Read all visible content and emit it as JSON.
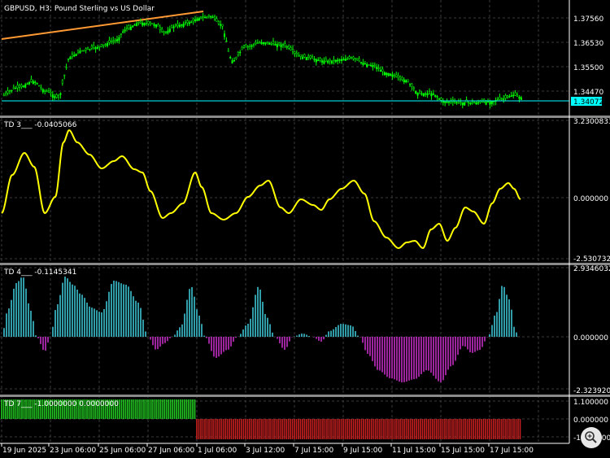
{
  "symbol_title": "GBPUSD, H3:  Pound Sterling vs US Dollar",
  "main_pane": {
    "price_labels": [
      "1.37560",
      "1.36530",
      "1.35500",
      "1.34470"
    ],
    "current_price": "1.34072",
    "colors": {
      "bull": "#00ff00",
      "trendline": "#ff9933",
      "hline": "#00ffff",
      "badge": "#00ffff"
    }
  },
  "pane_td3": {
    "label": "TD 3___ -0.0405066",
    "max_label": "3.2300833",
    "zero_label": "0.000000",
    "min_label": "-2.5307322",
    "line_color": "#ffff00"
  },
  "pane_td4": {
    "label": "TD 4___ -0.1145341",
    "max_label": "2.9346032",
    "zero_label": "0.000000",
    "min_label": "-2.3239202",
    "pos_color": "#40d0e0",
    "neg_color": "#d030d0"
  },
  "pane_td7": {
    "label": "TD 7___ -1.0000000 0.0000000",
    "max_label": "1.100000",
    "zero_label": "0.000000",
    "min_label": "-1.100000",
    "pos_color": "#22cc22",
    "neg_color": "#cc2020"
  },
  "time_axis": [
    "19 Jun 2025",
    "23 Jun 06:00",
    "25 Jun 06:00",
    "27 Jun 06:00",
    "1 Jul 06:00",
    "3 Jul 12:00",
    "7 Jul 15:00",
    "9 Jul 15:00",
    "11 Jul 15:00",
    "15 Jul 15:00",
    "17 Jul 15:00"
  ],
  "icons": {
    "zoom": "magnifier-icon"
  }
}
